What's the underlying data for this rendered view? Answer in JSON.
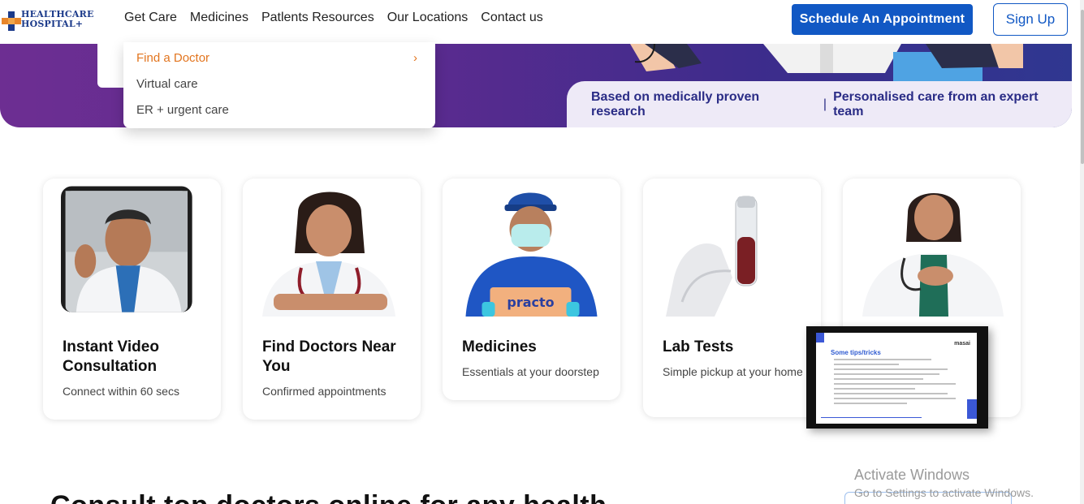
{
  "header": {
    "logo_text_line1": "HEALTHCARE",
    "logo_text_line2": "HOSPITAL+",
    "nav": [
      "Get Care",
      "Medicines",
      "Patlents Resources",
      "Our Locations",
      "Contact us"
    ],
    "schedule_button": "Schedule An Appointment",
    "signup_button": "Sign Up"
  },
  "dropdown": {
    "items": [
      "Find a Doctor",
      "Virtual care",
      "ER + urgent care"
    ],
    "chevron": "›"
  },
  "hero": {
    "ribbon_left": "Based on medically proven research",
    "ribbon_sep": "|",
    "ribbon_right": "Personalised care from an expert team"
  },
  "cards": [
    {
      "title": "Instant Video Consultation",
      "subtitle": "Connect within 60 secs",
      "icon": "video-doctor-image"
    },
    {
      "title": "Find Doctors Near You",
      "subtitle": "Confirmed appointments",
      "icon": "doctor-image"
    },
    {
      "title": "Medicines",
      "subtitle": "Essentials at your doorstep",
      "icon": "delivery-man-image",
      "box_label": "practo"
    },
    {
      "title": "Lab Tests",
      "subtitle": "Simple pickup at your home",
      "icon": "test-tube-image"
    },
    {
      "title": "",
      "subtitle": "",
      "icon": "surgeon-image"
    }
  ],
  "video_overlay": {
    "title": "Some tips/tricks",
    "brand": "masai"
  },
  "headline": "Consult top doctors online for any health",
  "watermark": {
    "title": "Activate Windows",
    "subtitle": "Go to Settings to activate Windows."
  },
  "colors": {
    "primary": "#1158c4",
    "accent": "#e2751f",
    "hero_start": "#6d2e92",
    "hero_end": "#2f3790"
  }
}
